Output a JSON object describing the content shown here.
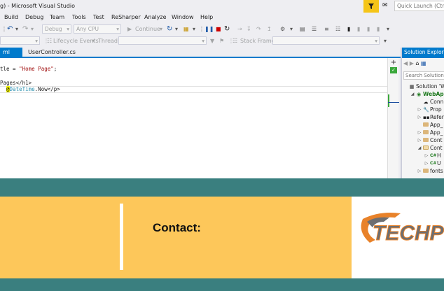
{
  "titlebar": {
    "title": "g) - Microsoft Visual Studio",
    "quick_launch_placeholder": "Quick Launch (Ctrl+"
  },
  "menu": [
    "Build",
    "Debug",
    "Team",
    "Tools",
    "Test",
    "ReSharper",
    "Analyze",
    "Window",
    "Help"
  ],
  "toolbar": {
    "config": "Debug",
    "platform": "Any CPU",
    "continue": "Continue"
  },
  "toolbar2": {
    "lifecycle": "Lifecycle Events",
    "thread": "Thread:",
    "stack_frame": "Stack Frame:"
  },
  "tabs": [
    "ml",
    "UserController.cs"
  ],
  "editor": {
    "line1_pre": "tle = ",
    "line1_str": "\"Home Page\"",
    "line1_post": ";",
    "line2": "Pages</h1>",
    "line3_razor": "@",
    "line3_type": "DateTime",
    "line3_post": ".Now</p>"
  },
  "solution_explorer": {
    "title": "Solution Explorer",
    "search_placeholder": "Search Solution E",
    "items": [
      {
        "label": "Solution 'W"
      },
      {
        "label": "WebApp"
      },
      {
        "label": "Conn"
      },
      {
        "label": "Prop"
      },
      {
        "label": "Refer"
      },
      {
        "label": "App_"
      },
      {
        "label": "App_"
      },
      {
        "label": "Cont"
      },
      {
        "label": "Cont"
      },
      {
        "label": "H"
      },
      {
        "label": "U"
      },
      {
        "label": "fonts"
      }
    ]
  },
  "slide": {
    "contact_label": "Contact:",
    "logo_text": "TECHP"
  },
  "colors": {
    "accent": "#007acc",
    "teal_band": "#3a7f7f",
    "yellow_panel": "#fdc75a",
    "logo_orange": "#e8822a",
    "logo_gray": "#6d6e71"
  }
}
